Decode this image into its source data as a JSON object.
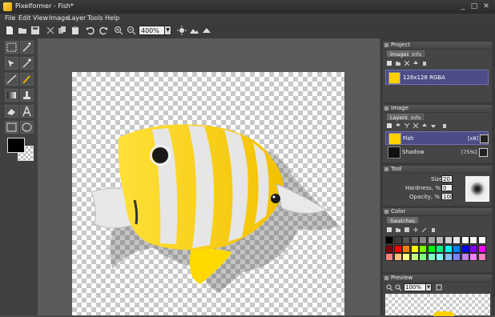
{
  "window": {
    "app": "Pixelformer",
    "title": "Pixelformer - Fish*",
    "minimize": "_",
    "maximize": "□",
    "close": "✕"
  },
  "menu": [
    "File",
    "Edit",
    "View",
    "Image",
    "Layer",
    "Tools",
    "Help"
  ],
  "toolbar": {
    "zoom": "400%"
  },
  "panels": {
    "project": {
      "title": "Project",
      "tabs": [
        "Images",
        "Info"
      ],
      "item_label": "128x128 RGBA"
    },
    "image": {
      "title": "Image",
      "tabs": [
        "Layers",
        "Info"
      ],
      "layers": [
        {
          "name": "Fish",
          "opacity": "[x8]"
        },
        {
          "name": "Shadow",
          "opacity": "[75%]"
        }
      ]
    },
    "tool": {
      "title": "Tool",
      "size_label": "Size:",
      "size_value": "20",
      "hardness_label": "Hardness, %",
      "hardness_value": "0",
      "opacity_label": "Opacity, %",
      "opacity_value": "100"
    },
    "color": {
      "title": "Color",
      "tab": "Swatches",
      "swatch_rows": [
        [
          "#000000",
          "#3c3c3c",
          "#555555",
          "#6e6e6e",
          "#878787",
          "#a0a0a0",
          "#b9b9b9",
          "#d2d2d2",
          "#ebebeb",
          "#ffffff",
          "#f4f4f4",
          "#ffffff"
        ],
        [
          "#800000",
          "#ff0000",
          "#ff8000",
          "#ffff00",
          "#80ff00",
          "#00ff00",
          "#00ff80",
          "#00ffff",
          "#0080ff",
          "#0000ff",
          "#8000ff",
          "#ff00ff"
        ],
        [
          "#ff8080",
          "#ffc080",
          "#ffff80",
          "#c0ff80",
          "#80ff80",
          "#80ffc0",
          "#80ffff",
          "#80c0ff",
          "#8080ff",
          "#c080ff",
          "#ff80ff",
          "#ff80c0"
        ]
      ]
    },
    "preview": {
      "title": "Preview",
      "zoom": "100%"
    }
  }
}
